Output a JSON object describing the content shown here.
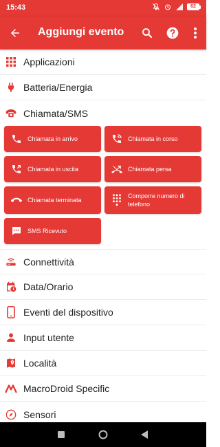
{
  "status": {
    "time": "15:43",
    "battery": "62"
  },
  "appbar": {
    "title": "Aggiungi evento"
  },
  "categories": [
    {
      "label": "Applicazioni",
      "icon": "apps-grid-icon"
    },
    {
      "label": "Batteria/Energia",
      "icon": "power-plug-icon"
    },
    {
      "label": "Chiamata/SMS",
      "icon": "phone-icon"
    },
    {
      "label": "Connettività",
      "icon": "router-icon"
    },
    {
      "label": "Data/Orario",
      "icon": "calendar-clock-icon"
    },
    {
      "label": "Eventi del dispositivo",
      "icon": "smartphone-icon"
    },
    {
      "label": "Input utente",
      "icon": "person-icon"
    },
    {
      "label": "Località",
      "icon": "map-pin-icon"
    },
    {
      "label": "MacroDroid Specific",
      "icon": "macrodroid-logo-icon"
    },
    {
      "label": "Sensori",
      "icon": "compass-icon"
    }
  ],
  "call_events": [
    {
      "label": "Chiamata in arrivo",
      "icon": "incoming-call-icon"
    },
    {
      "label": "Chiamata in corso",
      "icon": "call-active-icon"
    },
    {
      "label": "Chiamata in uscita",
      "icon": "outgoing-call-icon"
    },
    {
      "label": "Chiamata persa",
      "icon": "missed-call-icon"
    },
    {
      "label": "Chiamata terminata",
      "icon": "call-end-icon"
    },
    {
      "label": "Comporre numero di telefono",
      "icon": "dialpad-icon"
    },
    {
      "label": "SMS Ricevuto",
      "icon": "sms-icon"
    }
  ],
  "colors": {
    "accent": "#e53935",
    "text": "#212121",
    "divider": "#ececec"
  }
}
